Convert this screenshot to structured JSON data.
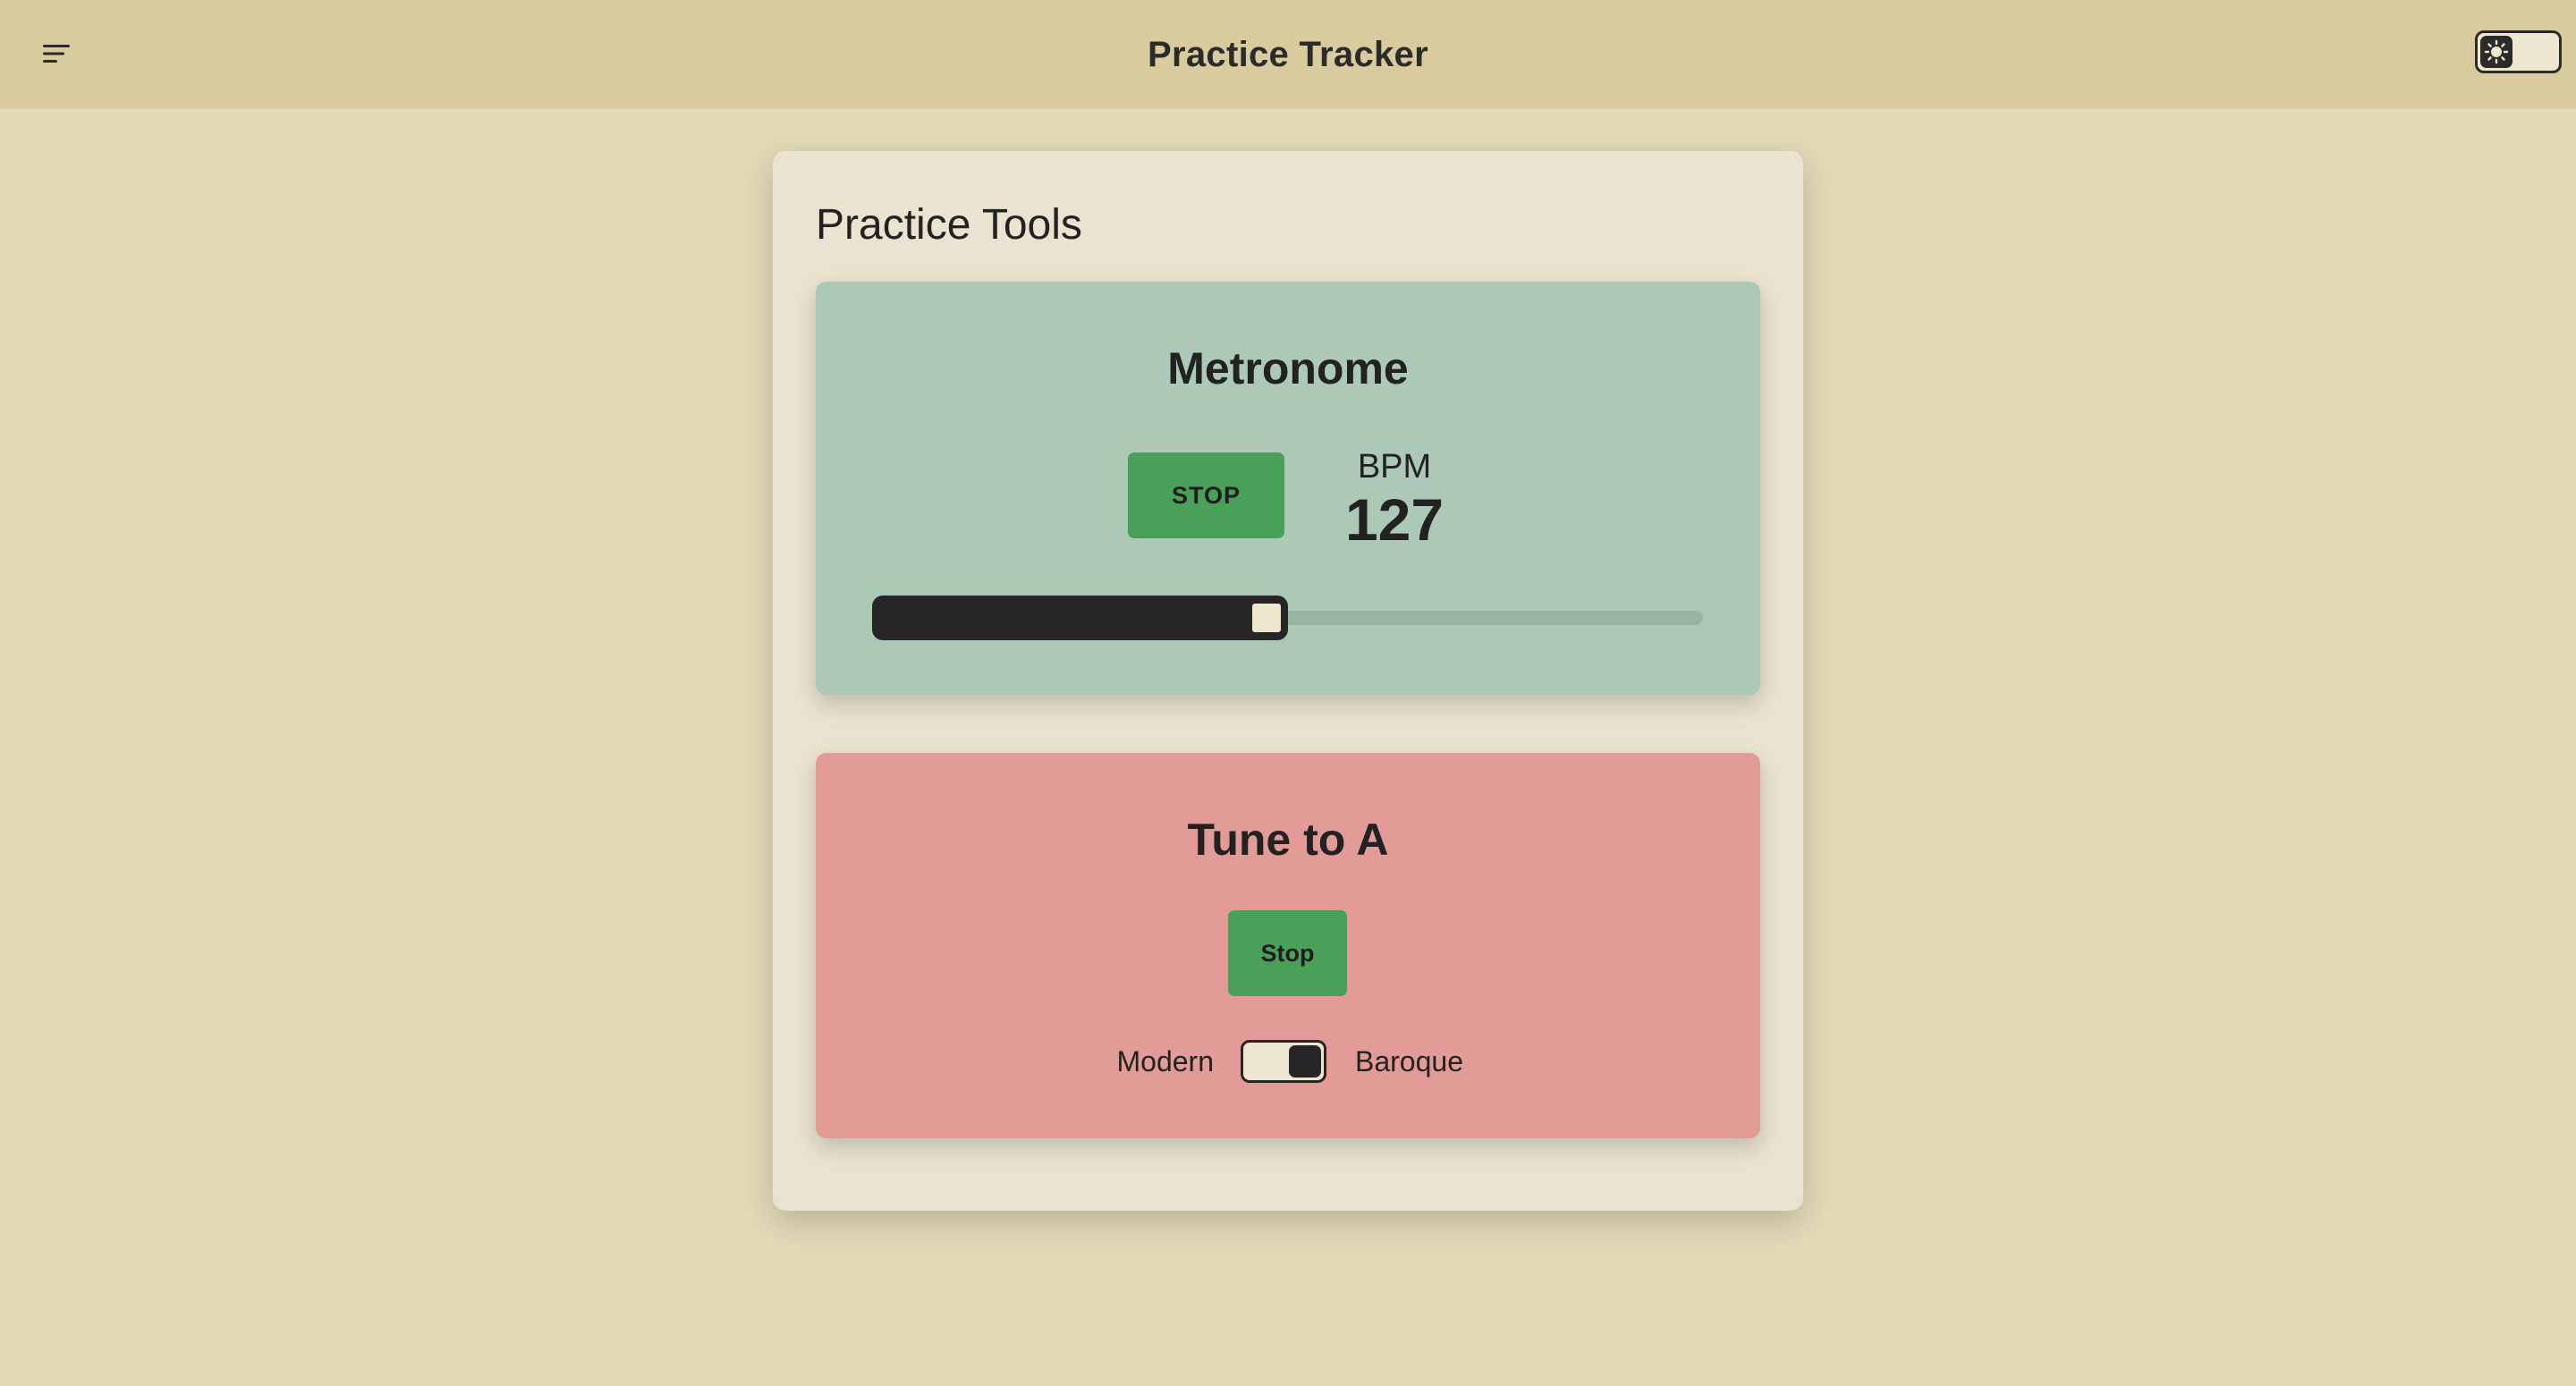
{
  "header": {
    "title": "Practice Tracker",
    "menu_icon": "hamburger-menu-icon",
    "theme_icon": "sun-icon",
    "theme_dark": false
  },
  "panel": {
    "title": "Practice Tools"
  },
  "metronome": {
    "title": "Metronome",
    "button_label": "STOP",
    "bpm_label": "BPM",
    "bpm_value": "127",
    "slider_fraction": 0.5,
    "bg_color": "#acc9b7",
    "button_color": "#4aa058"
  },
  "tuner": {
    "title": "Tune to A",
    "button_label": "Stop",
    "left_label": "Modern",
    "right_label": "Baroque",
    "baroque_selected": true,
    "bg_color": "#e29b96",
    "button_color": "#4aa058"
  }
}
